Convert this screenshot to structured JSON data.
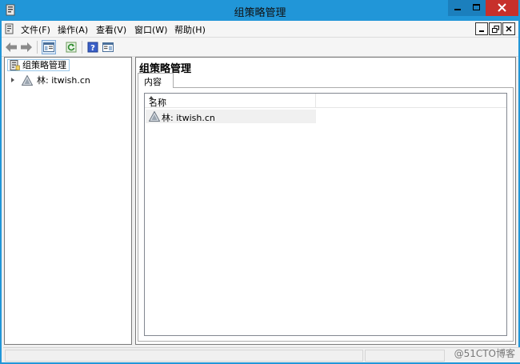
{
  "window": {
    "title": "组策略管理"
  },
  "menubar": {
    "items": [
      {
        "label": "文件(F)"
      },
      {
        "label": "操作(A)"
      },
      {
        "label": "查看(V)"
      },
      {
        "label": "窗口(W)"
      },
      {
        "label": "帮助(H)"
      }
    ]
  },
  "tree": {
    "root_label": "组策略管理",
    "child_label": "林: itwish.cn"
  },
  "main": {
    "title": "组策略管理",
    "tab_label": "内容",
    "list": {
      "column_header": "名称",
      "rows": [
        {
          "label": "林: itwish.cn"
        }
      ]
    }
  },
  "watermark": "@51CTO博客",
  "colors": {
    "titlebar": "#2196d8",
    "close_button": "#c7302b",
    "selection_border": "#99c8ea"
  }
}
